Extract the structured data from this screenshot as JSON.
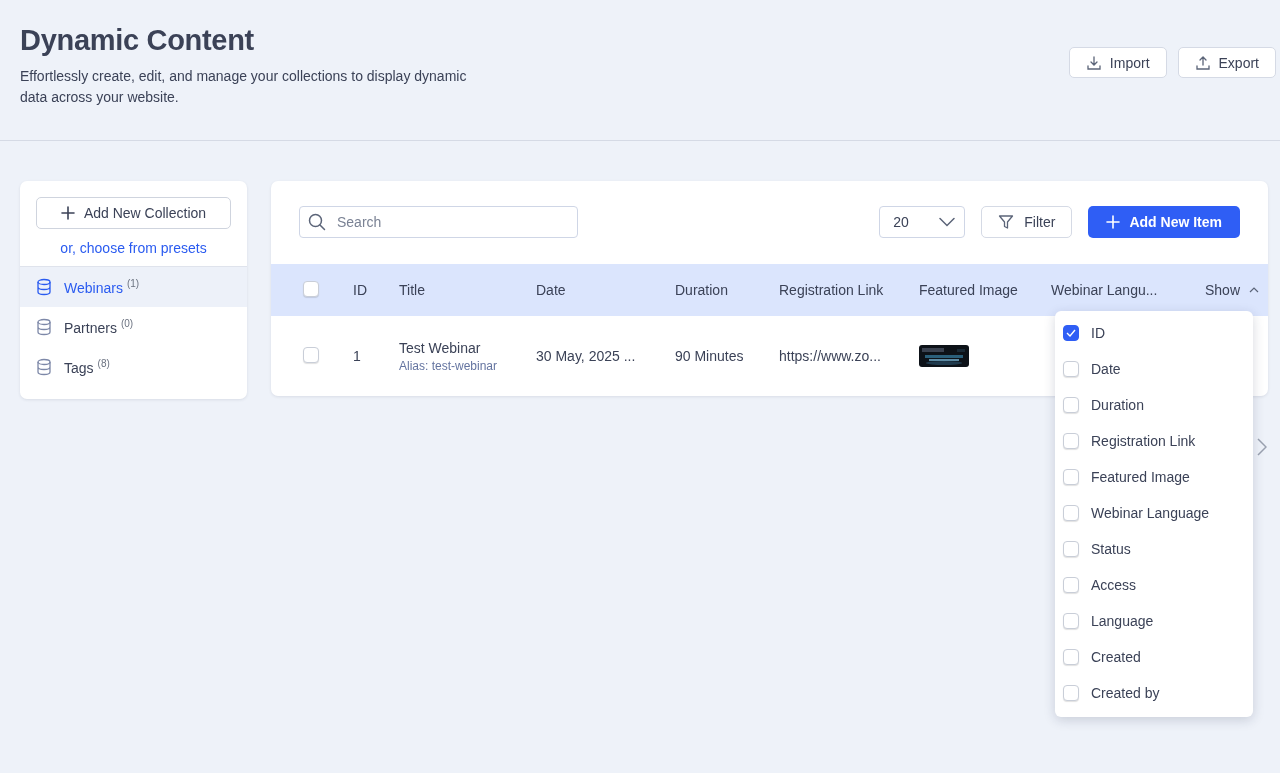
{
  "header": {
    "title": "Dynamic Content",
    "description": "Effortlessly create, edit, and manage your collections to display dynamic data across your website.",
    "buttons": [
      {
        "label": "Import",
        "kind": "import"
      },
      {
        "label": "Export",
        "kind": "export"
      }
    ]
  },
  "sidebar": {
    "add_button": "Add New Collection",
    "presets_link": "or, choose from presets",
    "items": [
      {
        "label": "Webinars",
        "count": "(1)",
        "selected": true
      },
      {
        "label": "Partners",
        "count": "(0)",
        "selected": false
      },
      {
        "label": "Tags",
        "count": "(8)",
        "selected": false
      }
    ]
  },
  "toolbar": {
    "search": {
      "placeholder": "Search"
    },
    "page_size": "20",
    "filter_button": "Filter",
    "add_button": "Add New Item"
  },
  "table": {
    "all_checked": false,
    "columns": [
      "ID",
      "Title",
      "Date",
      "Duration",
      "Registration Link",
      "Featured Image",
      "Webinar Langu..."
    ],
    "show_toggle": "Show",
    "rows": [
      {
        "checked": false,
        "id": "1",
        "title": "Test Webinar",
        "alias": "Alias: test-webinar",
        "date": "30 May, 2025 ...",
        "duration": "90 Minutes",
        "registration_link": "https://www.zo..."
      }
    ]
  },
  "column_menu": {
    "items": [
      {
        "label": "ID",
        "checked": true
      },
      {
        "label": "Date",
        "checked": false
      },
      {
        "label": "Duration",
        "checked": false
      },
      {
        "label": "Registration Link",
        "checked": false
      },
      {
        "label": "Featured Image",
        "checked": false
      },
      {
        "label": "Webinar Language",
        "checked": false
      },
      {
        "label": "Status",
        "checked": false
      },
      {
        "label": "Access",
        "checked": false
      },
      {
        "label": "Language",
        "checked": false
      },
      {
        "label": "Created",
        "checked": false
      },
      {
        "label": "Created by",
        "checked": false
      }
    ]
  }
}
